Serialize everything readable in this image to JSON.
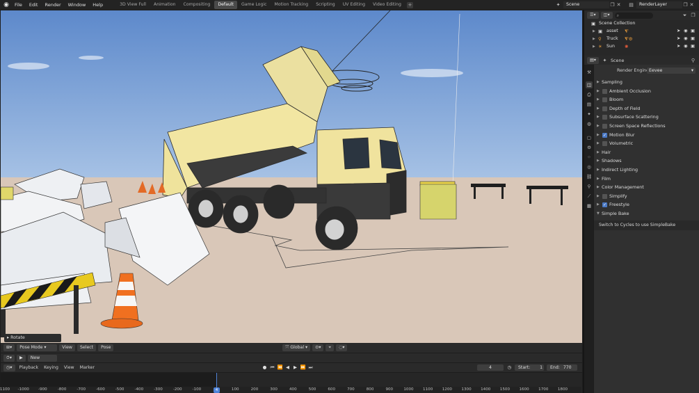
{
  "topbar": {
    "menus": [
      "File",
      "Edit",
      "Render",
      "Window",
      "Help"
    ],
    "workspaces": [
      "3D View Full",
      "Animation",
      "Compositing",
      "Default",
      "Game Logic",
      "Motion Tracking",
      "Scripting",
      "UV Editing",
      "Video Editing"
    ],
    "active_workspace": "Default",
    "add_label": "+",
    "scene": "Scene",
    "view_layer": "RenderLayer"
  },
  "viewport": {
    "operator_panel": "Rotate",
    "mode": "Pose Mode",
    "header_menus": [
      "View",
      "Select",
      "Pose"
    ],
    "transform_orientation": "Global"
  },
  "timeline": {
    "action_label": "New",
    "menus": [
      "Playback",
      "Keying",
      "View",
      "Marker"
    ],
    "current_frame": "4",
    "start_label": "Start:",
    "start": "1",
    "end_label": "End:",
    "end": "770",
    "ruler_ticks": [
      "-1100",
      "-1000",
      "-900",
      "-800",
      "-700",
      "-600",
      "-500",
      "-400",
      "-300",
      "-200",
      "-100",
      "100",
      "200",
      "300",
      "400",
      "500",
      "600",
      "700",
      "800",
      "900",
      "1000",
      "1100",
      "1200",
      "1300",
      "1400",
      "1500",
      "1600",
      "1700",
      "1800"
    ],
    "playhead_label": "4"
  },
  "outliner": {
    "collection": "Scene Collection",
    "items": [
      {
        "name": "asset"
      },
      {
        "name": "Truck"
      },
      {
        "name": "Sun"
      }
    ]
  },
  "properties": {
    "context": "Scene",
    "render_engine_label": "Render Engine",
    "render_engine": "Eevee",
    "sections": [
      {
        "label": "Sampling",
        "checkbox": null
      },
      {
        "label": "Ambient Occlusion",
        "checkbox": false
      },
      {
        "label": "Bloom",
        "checkbox": false
      },
      {
        "label": "Depth of Field",
        "checkbox": false
      },
      {
        "label": "Subsurface Scattering",
        "checkbox": false
      },
      {
        "label": "Screen Space Reflections",
        "checkbox": false
      },
      {
        "label": "Motion Blur",
        "checkbox": true
      },
      {
        "label": "Volumetric",
        "checkbox": false
      },
      {
        "label": "Hair",
        "checkbox": null
      },
      {
        "label": "Shadows",
        "checkbox": null
      },
      {
        "label": "Indirect Lighting",
        "checkbox": null
      },
      {
        "label": "Film",
        "checkbox": null
      },
      {
        "label": "Color Management",
        "checkbox": null
      },
      {
        "label": "Simplify",
        "checkbox": false
      },
      {
        "label": "Freestyle",
        "checkbox": true
      },
      {
        "label": "Simple Bake",
        "checkbox": null
      }
    ],
    "bake_note": "Switch to Cycles to use SimpleBake"
  },
  "colors": {
    "accent": "#4b79c4",
    "sky": "#6f97d0",
    "ground": "#d9c7b8",
    "truck_yellow": "#f2e6a2"
  }
}
